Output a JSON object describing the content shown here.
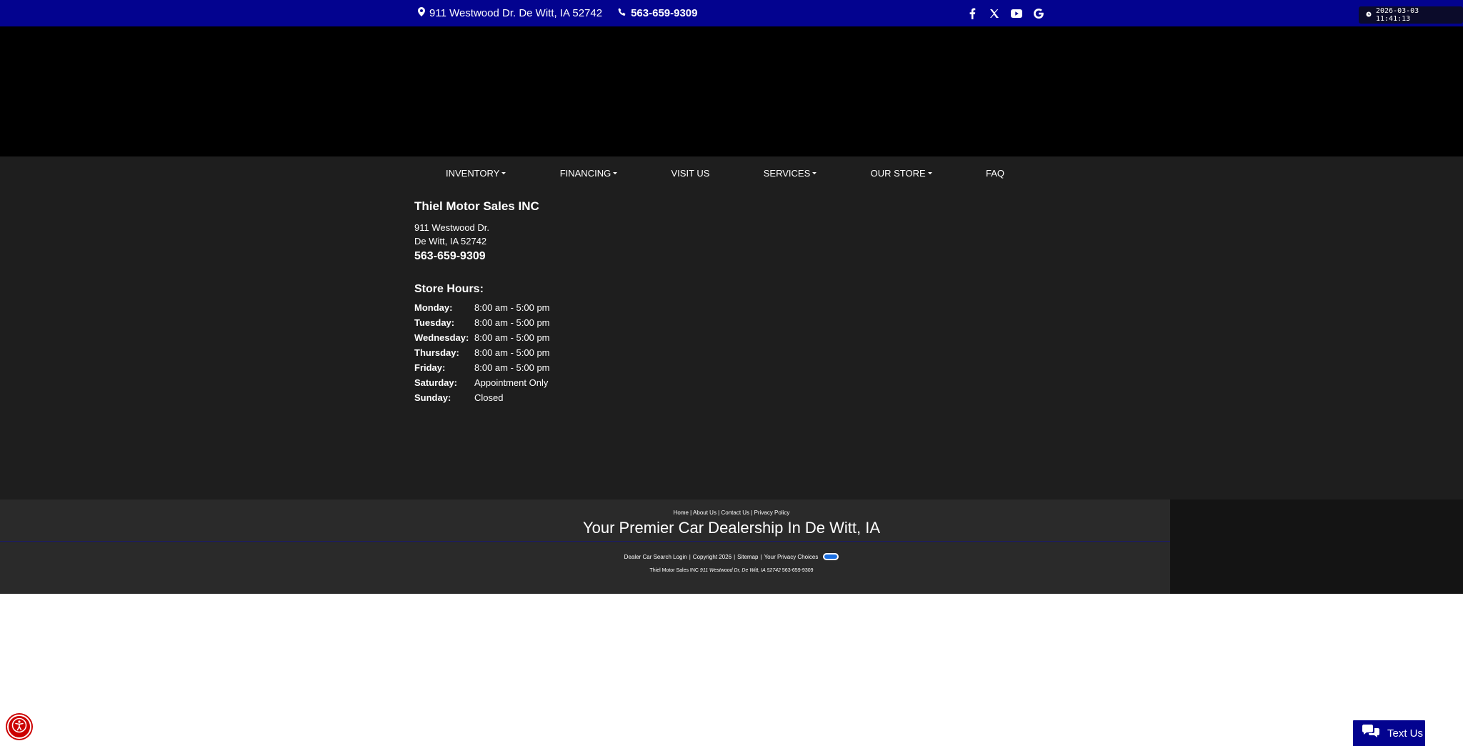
{
  "topbar": {
    "address": "911 Westwood Dr. De Witt, IA 52742",
    "phone": "563-659-9309",
    "social": [
      "facebook-icon",
      "x-twitter-icon",
      "youtube-icon",
      "google-icon"
    ],
    "datetime": "2026-03-03 11:41:13",
    "bg_color": "#03038f"
  },
  "nav": {
    "items": [
      {
        "label": "INVENTORY",
        "dropdown": true
      },
      {
        "label": "FINANCING",
        "dropdown": true
      },
      {
        "label": "VISIT US",
        "dropdown": false
      },
      {
        "label": "SERVICES",
        "dropdown": true
      },
      {
        "label": "OUR STORE",
        "dropdown": true
      },
      {
        "label": "FAQ",
        "dropdown": false
      }
    ]
  },
  "store": {
    "name": "Thiel Motor Sales INC",
    "street": "911 Westwood Dr.",
    "city": "De Witt, IA 52742",
    "phone": "563-659-9309",
    "hours_title": "Store Hours:",
    "hours": [
      {
        "day": "Monday:",
        "time": "8:00 am - 5:00 pm"
      },
      {
        "day": "Tuesday:",
        "time": "8:00 am - 5:00 pm"
      },
      {
        "day": "Wednesday:",
        "time": "8:00 am - 5:00 pm"
      },
      {
        "day": "Thursday:",
        "time": "8:00 am - 5:00 pm"
      },
      {
        "day": "Friday:",
        "time": "8:00 am - 5:00 pm"
      },
      {
        "day": "Saturday:",
        "time": "Appointment Only"
      },
      {
        "day": "Sunday:",
        "time": "Closed"
      }
    ]
  },
  "footer": {
    "links": [
      "Home",
      "About Us",
      "Contact Us",
      "Privacy Policy"
    ],
    "tagline": "Your Premier Car Dealership In De Witt, IA",
    "bottom_links": [
      "Dealer Car Search Login",
      "Copyright 2026",
      "Sitemap",
      "Your Privacy Choices"
    ],
    "dealer_name": "Thiel Motor Sales INC",
    "dealer_address": "911 Westwood Dr, De Witt, IA 52742",
    "dealer_phone": "563-659-9309"
  },
  "widgets": {
    "text_us_label": "Text Us",
    "accessibility_icon": "accessibility-icon"
  }
}
